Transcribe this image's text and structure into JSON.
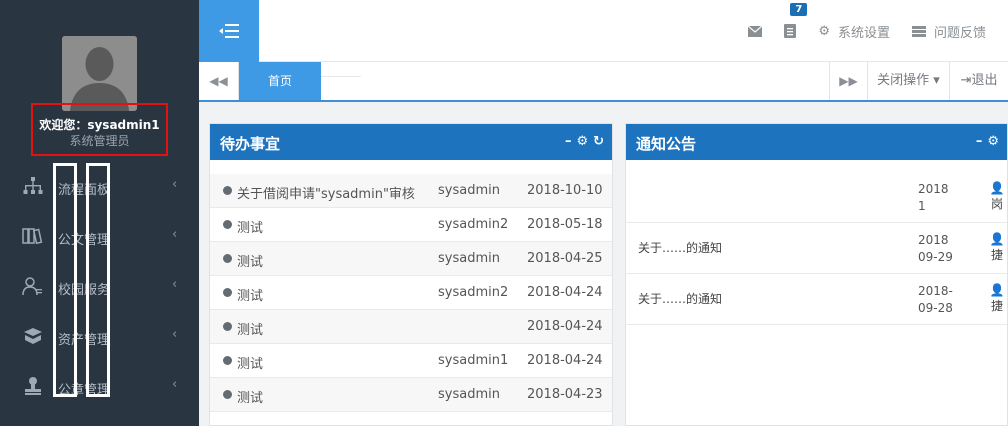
{
  "user": {
    "welcome": "欢迎您：sysadmin1",
    "role": "系统管理员"
  },
  "sidebar": {
    "items": [
      {
        "label": "流程面板",
        "icon": "sitemap-icon"
      },
      {
        "label": "公文管理",
        "icon": "books-icon"
      },
      {
        "label": "校园服务",
        "icon": "user-list-icon"
      },
      {
        "label": "资产管理",
        "icon": "box-icon"
      },
      {
        "label": "公章管理",
        "icon": "stamp-icon"
      }
    ]
  },
  "topbar": {
    "mail_icon": "envelope-icon",
    "task_badge": "7",
    "settings_label": "系统设置",
    "feedback_label": "问题反馈"
  },
  "tabs": {
    "active": "首页",
    "close_ops": "关闭操作",
    "exit": "退出"
  },
  "todo": {
    "title": "待办事宜",
    "rows": [
      {
        "title": "关于借阅申请\"sysadmin\"审核",
        "user": "sysadmin",
        "date": "2018-10-10"
      },
      {
        "title": "测试",
        "user": "sysadmin2",
        "date": "2018-05-18"
      },
      {
        "title": "测试",
        "user": "sysadmin",
        "date": "2018-04-25"
      },
      {
        "title": "测试",
        "user": "sysadmin2",
        "date": "2018-04-24"
      },
      {
        "title": "测试",
        "user": "",
        "date": "2018-04-24"
      },
      {
        "title": "测试",
        "user": "sysadmin1",
        "date": "2018-04-24"
      },
      {
        "title": "测试",
        "user": "sysadmin",
        "date": "2018-04-23"
      }
    ]
  },
  "notice": {
    "title": "通知公告",
    "rows": [
      {
        "title": "",
        "date_line1": "2018",
        "date_line2": "1",
        "user": "岗"
      },
      {
        "title": "关于……的通知",
        "date_line1": "2018",
        "date_line2": "09-29",
        "user": "捷"
      },
      {
        "title": "关于……的通知",
        "date_line1": "2018-",
        "date_line2": "09-28",
        "user": "捷"
      }
    ]
  },
  "colors": {
    "sidebar": "#2a3542",
    "accent": "#3f9ae6",
    "panel_head": "#1e73be",
    "highlight": "#e3120f"
  }
}
